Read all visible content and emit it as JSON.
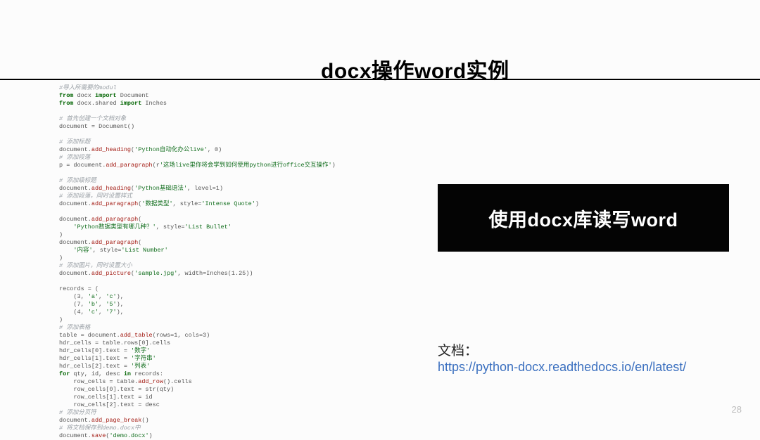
{
  "title": "docx操作word实例",
  "black_box": "使用docx库读写word",
  "doc_label": "文档：",
  "doc_link": "https://python-docx.readthedocs.io/en/latest/",
  "page_number": "28",
  "code": {
    "l01": "#导入所需要的modul",
    "l02a": "from",
    "l02b": " docx ",
    "l02c": "import",
    "l02d": " Document",
    "l03a": "from",
    "l03b": " docx.shared ",
    "l03c": "import",
    "l03d": " Inches",
    "l04": "",
    "l05": "# 首先创建一个文档对象",
    "l06": "document = Document()",
    "l07": "",
    "l08": "# 添加标题",
    "l09a": "document.",
    "l09b": "add_heading",
    "l09c": "(",
    "l09d": "'Python自动化办公live'",
    "l09e": ", 0)",
    "l10": "# 添加段落",
    "l11a": "p = document.",
    "l11b": "add_paragraph",
    "l11c": "(r",
    "l11d": "'这场live里你将会学到如何使用python进行office交互操作'",
    "l11e": ")",
    "l12": "",
    "l13": "# 添加级标题",
    "l14a": "document.",
    "l14b": "add_heading",
    "l14c": "(",
    "l14d": "'Python基础语法'",
    "l14e": ", level=1)",
    "l15": "# 添加段落，同时设置样式",
    "l16a": "document.",
    "l16b": "add_paragraph",
    "l16c": "(",
    "l16d": "'数据类型'",
    "l16e": ", style=",
    "l16f": "'Intense Quote'",
    "l16g": ")",
    "l17": "",
    "l18a": "document.",
    "l18b": "add_paragraph",
    "l18c": "(",
    "l19a": "    ",
    "l19b": "'Python数据类型有哪几种？'",
    "l19c": ", style=",
    "l19d": "'List Bullet'",
    "l20": ")",
    "l21a": "document.",
    "l21b": "add_paragraph",
    "l21c": "(",
    "l22a": "    ",
    "l22b": "'内容'",
    "l22c": ", style=",
    "l22d": "'List Number'",
    "l23": ")",
    "l24": "# 添加图片，同时设置大小",
    "l25a": "document.",
    "l25b": "add_picture",
    "l25c": "(",
    "l25d": "'sample.jpg'",
    "l25e": ", width=Inches(1.25))",
    "l26": "",
    "l27": "records = (",
    "l28a": "    (3, ",
    "l28b": "'a'",
    "l28c": ", ",
    "l28d": "'c'",
    "l28e": "),",
    "l29a": "    (7, ",
    "l29b": "'b'",
    "l29c": ", ",
    "l29d": "'5'",
    "l29e": "),",
    "l30a": "    (4, ",
    "l30b": "'c'",
    "l30c": ", ",
    "l30d": "'7'",
    "l30e": "),",
    "l31": ")",
    "l32": "# 添加表格",
    "l33a": "table = document.",
    "l33b": "add_table",
    "l33c": "(rows=1, cols=3)",
    "l34": "hdr_cells = table.rows[0].cells",
    "l35a": "hdr_cells[0].text = ",
    "l35b": "'数字'",
    "l36a": "hdr_cells[1].text = ",
    "l36b": "'字符串'",
    "l37a": "hdr_cells[2].text = ",
    "l37b": "'列表'",
    "l38a": "for",
    "l38b": " qty, id, desc ",
    "l38c": "in",
    "l38d": " records:",
    "l39a": "    row_cells = table.",
    "l39b": "add_row",
    "l39c": "().cells",
    "l40": "    row_cells[0].text = str(qty)",
    "l41": "    row_cells[1].text = id",
    "l42": "    row_cells[2].text = desc",
    "l43": "# 添加分页符",
    "l44a": "document.",
    "l44b": "add_page_break",
    "l44c": "()",
    "l45": "# 将文档保存到demo.docx中",
    "l46a": "document.",
    "l46b": "save",
    "l46c": "(",
    "l46d": "'demo.docx'",
    "l46e": ")"
  }
}
